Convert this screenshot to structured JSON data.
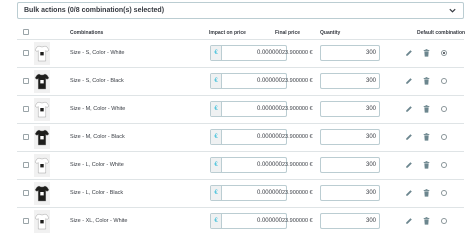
{
  "bulk_actions": {
    "label": "Bulk actions (0/8 combination(s) selected)"
  },
  "columns": {
    "combinations": "Combinations",
    "impact_on_price": "Impact on price",
    "final_price": "Final price",
    "quantity": "Quantity",
    "default_combination": "Default combination"
  },
  "currency_symbol": "€",
  "rows": [
    {
      "name": "Size - S, Color - White",
      "shirt": "white",
      "impact": "0.000000",
      "final": "23.900000 €",
      "quantity": "300",
      "default": true
    },
    {
      "name": "Size - S, Color - Black",
      "shirt": "black",
      "impact": "0.000000",
      "final": "23.900000 €",
      "quantity": "300",
      "default": false
    },
    {
      "name": "Size - M, Color - White",
      "shirt": "white",
      "impact": "0.000000",
      "final": "23.900000 €",
      "quantity": "300",
      "default": false
    },
    {
      "name": "Size - M, Color - Black",
      "shirt": "black",
      "impact": "0.000000",
      "final": "23.900000 €",
      "quantity": "300",
      "default": false
    },
    {
      "name": "Size - L, Color - White",
      "shirt": "white",
      "impact": "0.000000",
      "final": "23.900000 €",
      "quantity": "300",
      "default": false
    },
    {
      "name": "Size - L, Color - Black",
      "shirt": "black",
      "impact": "0.000000",
      "final": "23.900000 €",
      "quantity": "300",
      "default": false
    },
    {
      "name": "Size - XL, Color - White",
      "shirt": "white",
      "impact": "0.000000",
      "final": "23.900000 €",
      "quantity": "300",
      "default": false
    }
  ],
  "icons": {
    "edit": "pencil-icon",
    "delete": "trash-icon",
    "bulk": "chevron-down-icon"
  },
  "colors": {
    "accent": "#25b9d7",
    "action_icon": "#6c868e",
    "border": "#bbcdd2",
    "shirt_white": "#ffffff",
    "shirt_black": "#1d1d1b"
  }
}
